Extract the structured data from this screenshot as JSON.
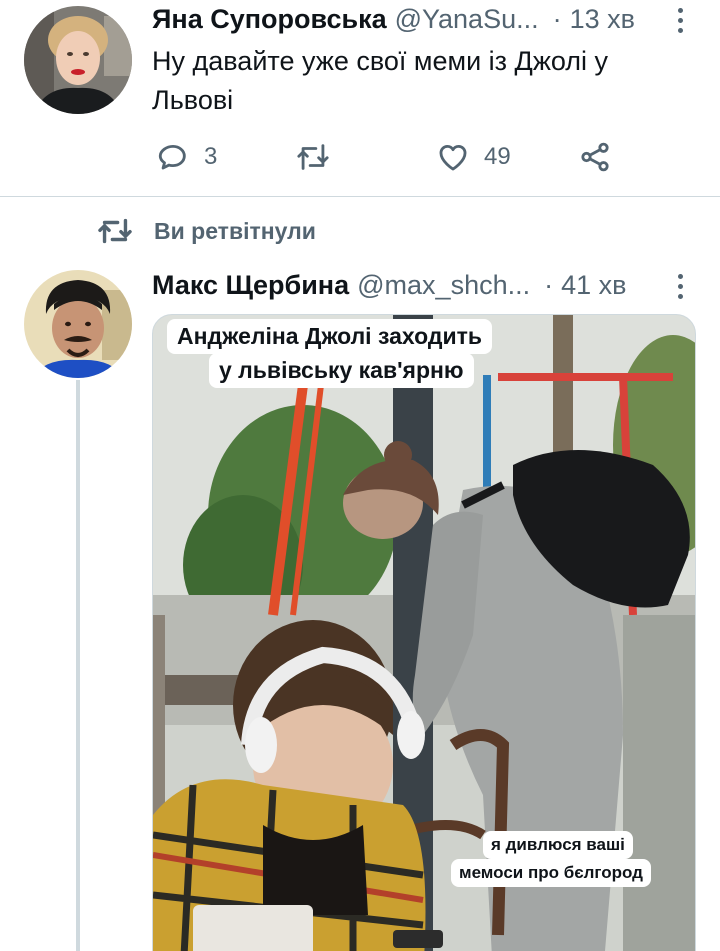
{
  "tweet1": {
    "name": "Яна Супоровська",
    "handle": "@YanaSu...",
    "dot": "·",
    "time": "13 хв",
    "text_line1": "Ну давайте уже свої меми із Джолі у",
    "text_line2": "Львові",
    "reply_count": "3",
    "like_count": "49"
  },
  "retweet_notice": {
    "label": "Ви ретвітнули"
  },
  "tweet2": {
    "name": "Макс Щербина",
    "handle": "@max_shch...",
    "dot": "·",
    "time": "41 хв",
    "meme": {
      "caption_top_line1": "Анджеліна Джолі заходить",
      "caption_top_line2": "у львівську кав'ярню",
      "caption_bottom_line1": "я дивлюся ваші",
      "caption_bottom_line2": "мемоси про бєлгород"
    }
  },
  "colors": {
    "text_primary": "#0f1419",
    "text_secondary": "#536471",
    "divider": "#cfd9de",
    "background": "#ffffff"
  },
  "icons": [
    "more-vertical-icon",
    "reply-icon",
    "retweet-icon",
    "like-icon",
    "share-icon"
  ]
}
